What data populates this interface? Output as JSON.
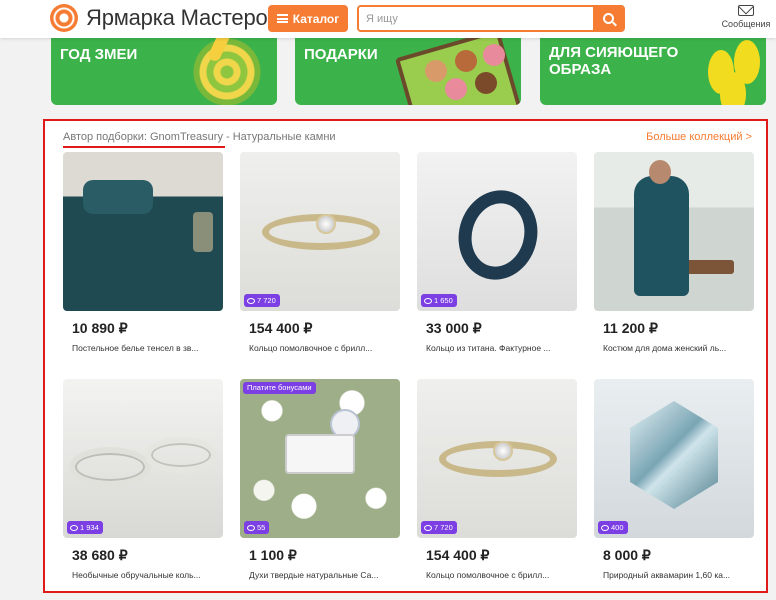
{
  "header": {
    "logo_text": "Ярмарка Мастеров",
    "catalog_label": "Каталог",
    "search_placeholder": "Я ищу",
    "messages_label": "Сообщения"
  },
  "banners": [
    {
      "title_line1": "ГОД ЗМЕИ",
      "title_line2": ""
    },
    {
      "title_line1": "ПОДАРКИ",
      "title_line2": ""
    },
    {
      "title_line1": "ДЛЯ СИЯЮЩЕГО",
      "title_line2": "ОБРАЗА"
    }
  ],
  "collection": {
    "author": "Автор подборки: GnomTreasury",
    "subtitle": " - Натуральные камни",
    "more_label": "Больше коллекций >",
    "items": [
      {
        "price": "10 890 ₽",
        "name": "Постельное белье тенсел в зв...",
        "bonus": "",
        "promo": "",
        "image": "bedding"
      },
      {
        "price": "154 400 ₽",
        "name": "Кольцо помолвочное с брилл...",
        "bonus": "7 720",
        "promo": "",
        "image": "ring-gold"
      },
      {
        "price": "33 000 ₽",
        "name": "Кольцо из титана. Фактурное ...",
        "bonus": "1 650",
        "promo": "",
        "image": "titanium-ring"
      },
      {
        "price": "11 200 ₽",
        "name": "Костюм для дома женский ль...",
        "bonus": "",
        "promo": "",
        "image": "suit"
      },
      {
        "price": "38 680 ₽",
        "name": "Необычные обручальные коль...",
        "bonus": "1 934",
        "promo": "",
        "image": "wedding-rings"
      },
      {
        "price": "1 100 ₽",
        "name": "Духи твердые натуральные Са...",
        "bonus": "55",
        "promo": "Платите бонусами",
        "image": "perfume"
      },
      {
        "price": "154 400 ₽",
        "name": "Кольцо помолвочное с брилл...",
        "bonus": "7 720",
        "promo": "",
        "image": "ring-gold"
      },
      {
        "price": "8 000 ₽",
        "name": "Природный аквамарин 1,60 ка...",
        "bonus": "400",
        "promo": "",
        "image": "aquamarine"
      }
    ]
  },
  "colors": {
    "accent": "#f57c32",
    "highlight": "#e01919",
    "bonus": "#7b3fe4",
    "banner_green": "#3cb34a"
  }
}
